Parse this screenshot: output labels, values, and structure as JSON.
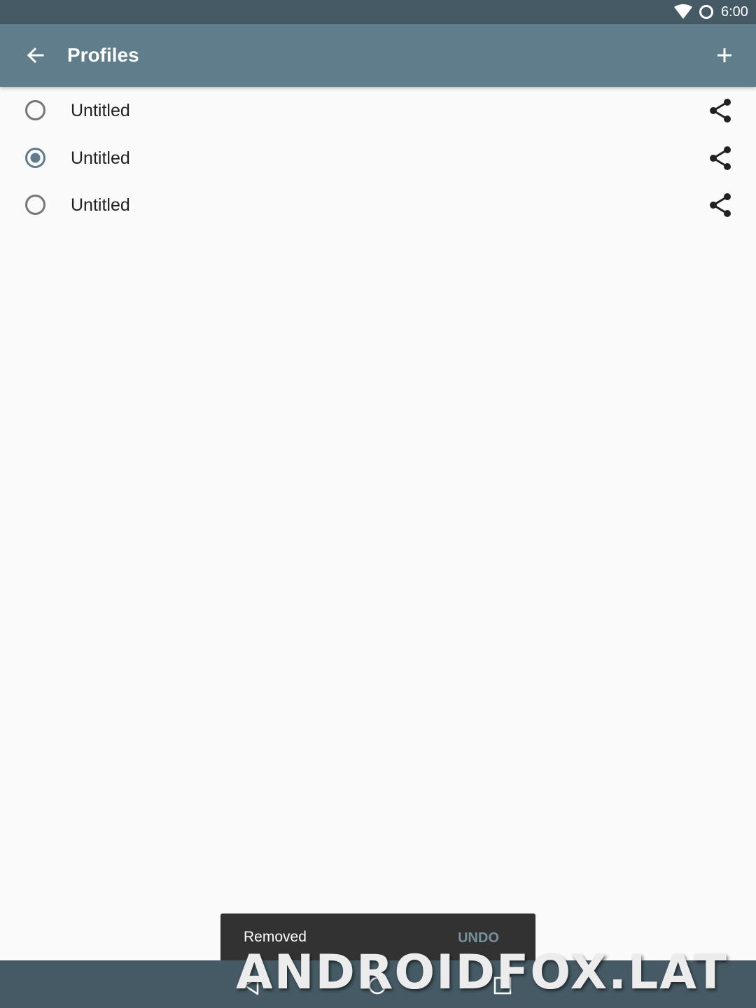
{
  "status_bar": {
    "time": "6:00",
    "icons": [
      "wifi-icon",
      "battery-icon"
    ]
  },
  "app_bar": {
    "title": "Profiles",
    "back_icon": "arrow-back-icon",
    "add_icon": "add-icon"
  },
  "profiles": [
    {
      "label": "Untitled",
      "selected": false
    },
    {
      "label": "Untitled",
      "selected": true
    },
    {
      "label": "Untitled",
      "selected": false
    }
  ],
  "snackbar": {
    "message": "Removed",
    "action": "UNDO"
  },
  "nav_bar": {
    "icons": [
      "nav-back-icon",
      "nav-home-icon",
      "nav-recents-icon"
    ]
  },
  "watermark": "ANDROIDFOX.LAT",
  "colors": {
    "status_bar": "#455a64",
    "app_bar": "#607d8b",
    "accent": "#607d8b",
    "background": "#fafafa",
    "snackbar": "#323232",
    "snackbar_action": "#78909c"
  }
}
